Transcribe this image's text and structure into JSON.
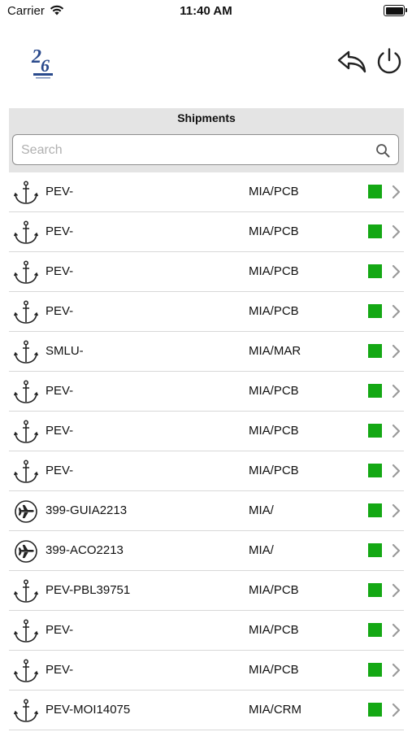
{
  "status_bar": {
    "carrier": "Carrier",
    "time": "11:40 AM"
  },
  "header": {
    "logo_icon": "company-logo-26",
    "back_icon": "reply-arrow-icon",
    "power_icon": "power-icon"
  },
  "title": "Shipments",
  "search": {
    "placeholder": "Search",
    "value": ""
  },
  "colors": {
    "status_ok": "#14a814",
    "header_bg": "#e4e4e4"
  },
  "shipments": [
    {
      "mode": "ocean",
      "ref": "PEV-",
      "route": "MIA/PCB",
      "status": "green"
    },
    {
      "mode": "ocean",
      "ref": "PEV-",
      "route": "MIA/PCB",
      "status": "green"
    },
    {
      "mode": "ocean",
      "ref": "PEV-",
      "route": "MIA/PCB",
      "status": "green"
    },
    {
      "mode": "ocean",
      "ref": "PEV-",
      "route": "MIA/PCB",
      "status": "green"
    },
    {
      "mode": "ocean",
      "ref": "SMLU-",
      "route": "MIA/MAR",
      "status": "green"
    },
    {
      "mode": "ocean",
      "ref": "PEV-",
      "route": "MIA/PCB",
      "status": "green"
    },
    {
      "mode": "ocean",
      "ref": "PEV-",
      "route": "MIA/PCB",
      "status": "green"
    },
    {
      "mode": "ocean",
      "ref": "PEV-",
      "route": "MIA/PCB",
      "status": "green"
    },
    {
      "mode": "air",
      "ref": "399-GUIA2213",
      "route": "MIA/",
      "status": "green"
    },
    {
      "mode": "air",
      "ref": "399-ACO2213",
      "route": "MIA/",
      "status": "green"
    },
    {
      "mode": "ocean",
      "ref": "PEV-PBL39751",
      "route": "MIA/PCB",
      "status": "green"
    },
    {
      "mode": "ocean",
      "ref": "PEV-",
      "route": "MIA/PCB",
      "status": "green"
    },
    {
      "mode": "ocean",
      "ref": "PEV-",
      "route": "MIA/PCB",
      "status": "green"
    },
    {
      "mode": "ocean",
      "ref": "PEV-MOI14075",
      "route": "MIA/CRM",
      "status": "green"
    }
  ]
}
